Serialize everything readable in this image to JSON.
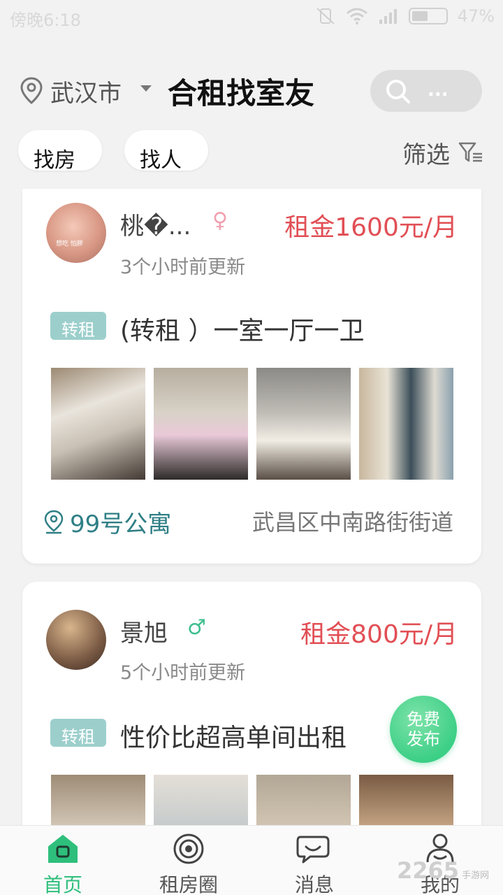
{
  "status_bar": {
    "time": "傍晚6:18",
    "battery": "47%",
    "battery_level": 0.47
  },
  "header": {
    "city": "武汉市",
    "title": "合租找室友",
    "search_placeholder": "..."
  },
  "tabs": {
    "find_room": "找房",
    "find_person": "找人",
    "filter": "筛选"
  },
  "listings": [
    {
      "name": "桃�...",
      "gender_icon": "female-icon",
      "updated": "3个小时前更新",
      "rent": "租金1600元/月",
      "tag": "转租",
      "title": "(转租 ）一室一厅一卫",
      "building": "99号公寓",
      "district": "武昌区中南路街街道",
      "avatar_caption": "想吃 怕胖"
    },
    {
      "name": "景旭",
      "gender_icon": "male-icon",
      "updated": "5个小时前更新",
      "rent": "租金800元/月",
      "tag": "转租",
      "title": "性价比超高单间出租"
    }
  ],
  "publish_button": {
    "line1": "免费",
    "line2": "发布"
  },
  "bottom_nav": [
    {
      "label": "首页",
      "icon": "home-icon",
      "active": true
    },
    {
      "label": "租房圈",
      "icon": "circle-icon",
      "active": false
    },
    {
      "label": "消息",
      "icon": "message-icon",
      "active": false
    },
    {
      "label": "我的",
      "icon": "profile-icon",
      "active": false
    }
  ],
  "watermark": {
    "text": "2265",
    "sub": "手游网"
  },
  "colors": {
    "accent": "#2ebf7c",
    "rent": "#e14f55",
    "tag": "#9ccfcc",
    "building": "#2f7f86"
  }
}
